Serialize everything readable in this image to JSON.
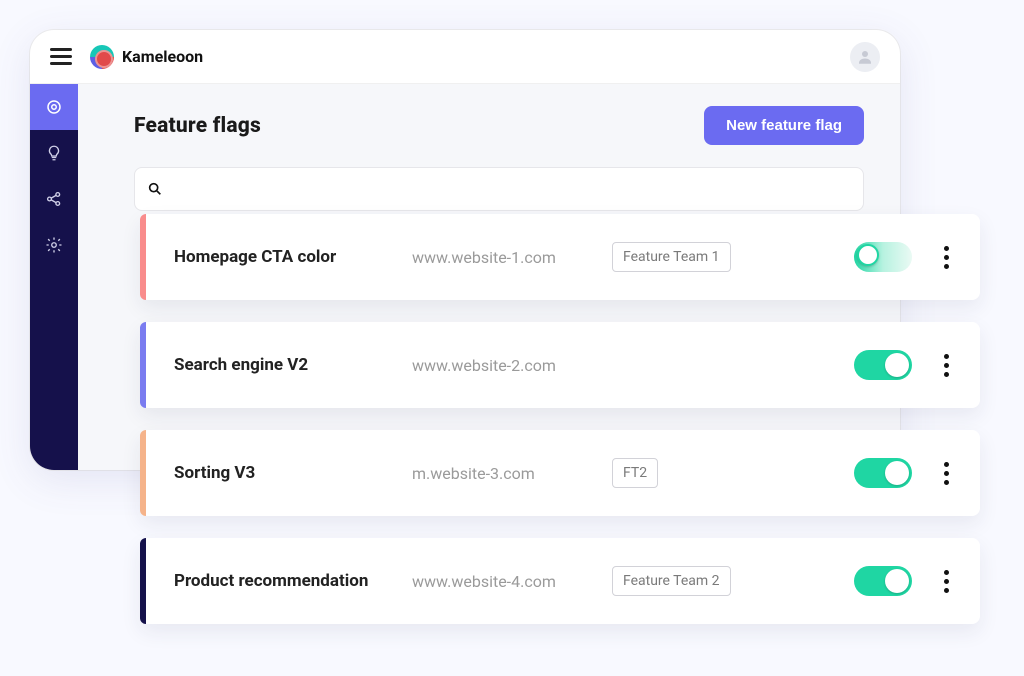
{
  "brand": "Kameleoon",
  "page_title": "Feature flags",
  "new_flag_button": "New feature flag",
  "search_placeholder": "",
  "sidebar": {
    "items": [
      {
        "name": "target-icon",
        "active": true
      },
      {
        "name": "lightbulb-icon",
        "active": false
      },
      {
        "name": "nodes-icon",
        "active": false
      },
      {
        "name": "gear-icon",
        "active": false
      }
    ]
  },
  "flags": [
    {
      "name": "Homepage CTA color",
      "domain": "www.website-1.com",
      "team": "Feature Team 1",
      "accent": "#f98c8c",
      "toggle": "mid"
    },
    {
      "name": "Search engine V2",
      "domain": "www.website-2.com",
      "team": "",
      "accent": "#7a7cf0",
      "toggle": "on"
    },
    {
      "name": "Sorting V3",
      "domain": "m.website-3.com",
      "team": "FT2",
      "accent": "#f5b38a",
      "toggle": "on"
    },
    {
      "name": "Product recommendation",
      "domain": "www.website-4.com",
      "team": "Feature Team 2",
      "accent": "#15114b",
      "toggle": "on"
    }
  ]
}
